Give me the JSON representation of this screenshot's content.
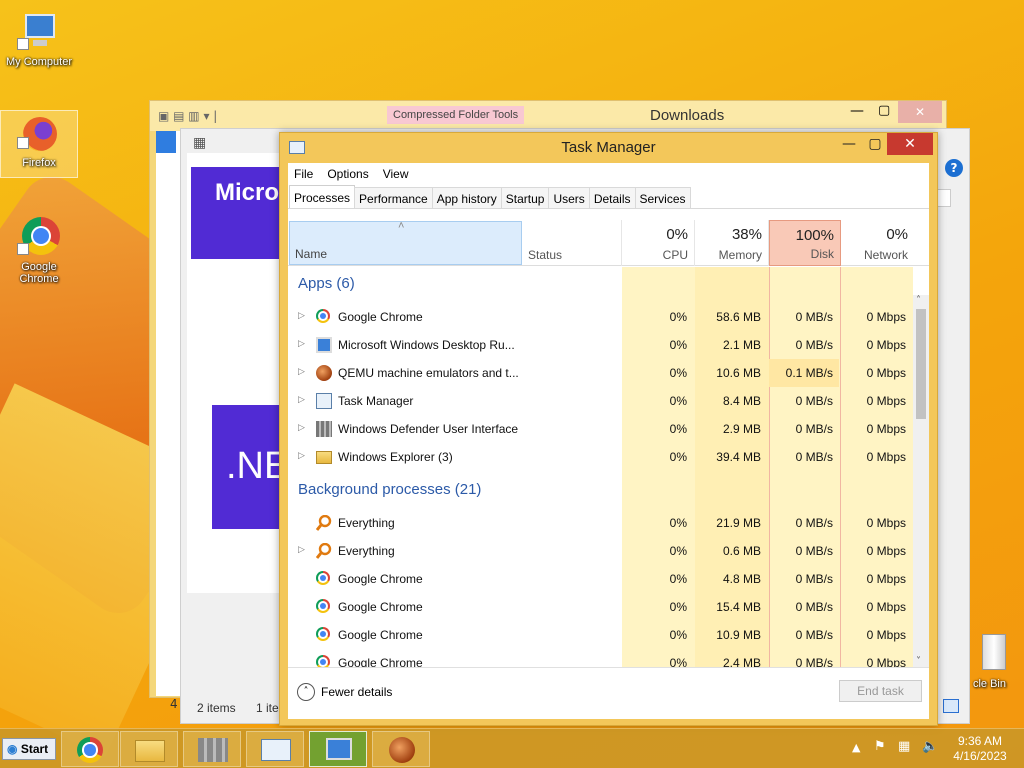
{
  "desktop": {
    "icons": [
      {
        "label": "My Computer"
      },
      {
        "label": "Firefox"
      },
      {
        "label": "Google Chrome"
      },
      {
        "label": "cle Bin"
      }
    ]
  },
  "explorer": {
    "ribbon_context": "Compressed Folder Tools",
    "title": "Downloads",
    "status_items": "2 items",
    "status_sel": "1 ite",
    "status_left": "4",
    "inner_heading": "Micro",
    "inner_logo": ".NE"
  },
  "task_manager": {
    "title": "Task Manager",
    "menu": [
      "File",
      "Options",
      "View"
    ],
    "tabs": [
      "Processes",
      "Performance",
      "App history",
      "Startup",
      "Users",
      "Details",
      "Services"
    ],
    "columns": {
      "name": "Name",
      "status": "Status",
      "cpu": {
        "pct": "0%",
        "label": "CPU"
      },
      "memory": {
        "pct": "38%",
        "label": "Memory"
      },
      "disk": {
        "pct": "100%",
        "label": "Disk"
      },
      "network": {
        "pct": "0%",
        "label": "Network"
      }
    },
    "groups": {
      "apps": "Apps (6)",
      "background": "Background processes (21)"
    },
    "apps": [
      {
        "name": "Google Chrome",
        "cpu": "0%",
        "mem": "58.6 MB",
        "disk": "0 MB/s",
        "net": "0 Mbps",
        "icon": "chrome-icon"
      },
      {
        "name": "Microsoft Windows Desktop Ru...",
        "cpu": "0%",
        "mem": "2.1 MB",
        "disk": "0 MB/s",
        "net": "0 Mbps",
        "icon": "remote-desktop-icon"
      },
      {
        "name": "QEMU machine emulators and t...",
        "cpu": "0%",
        "mem": "10.6 MB",
        "disk": "0.1 MB/s",
        "net": "0 Mbps",
        "icon": "qemu-icon"
      },
      {
        "name": "Task Manager",
        "cpu": "0%",
        "mem": "8.4 MB",
        "disk": "0 MB/s",
        "net": "0 Mbps",
        "icon": "task-manager-icon"
      },
      {
        "name": "Windows Defender User Interface",
        "cpu": "0%",
        "mem": "2.9 MB",
        "disk": "0 MB/s",
        "net": "0 Mbps",
        "icon": "defender-icon"
      },
      {
        "name": "Windows Explorer (3)",
        "cpu": "0%",
        "mem": "39.4 MB",
        "disk": "0 MB/s",
        "net": "0 Mbps",
        "icon": "folder-icon"
      }
    ],
    "background": [
      {
        "name": "Everything",
        "cpu": "0%",
        "mem": "21.9 MB",
        "disk": "0 MB/s",
        "net": "0 Mbps",
        "icon": "search-icon",
        "expand": false
      },
      {
        "name": "Everything",
        "cpu": "0%",
        "mem": "0.6 MB",
        "disk": "0 MB/s",
        "net": "0 Mbps",
        "icon": "search-icon",
        "expand": true
      },
      {
        "name": "Google Chrome",
        "cpu": "0%",
        "mem": "4.8 MB",
        "disk": "0 MB/s",
        "net": "0 Mbps",
        "icon": "chrome-icon",
        "expand": false
      },
      {
        "name": "Google Chrome",
        "cpu": "0%",
        "mem": "15.4 MB",
        "disk": "0 MB/s",
        "net": "0 Mbps",
        "icon": "chrome-icon",
        "expand": false
      },
      {
        "name": "Google Chrome",
        "cpu": "0%",
        "mem": "10.9 MB",
        "disk": "0 MB/s",
        "net": "0 Mbps",
        "icon": "chrome-icon",
        "expand": false
      },
      {
        "name": "Google Chrome",
        "cpu": "0%",
        "mem": "2.4 MB",
        "disk": "0 MB/s",
        "net": "0 Mbps",
        "icon": "chrome-icon",
        "expand": false
      }
    ],
    "fewer_details": "Fewer details",
    "end_task": "End task"
  },
  "taskbar": {
    "start": "Start",
    "time": "9:36 AM",
    "date": "4/16/2023"
  },
  "colors": {
    "accent": "#f3c75a",
    "disk_highlight": "#f9c9b7",
    "heat_light": "#fff4c4",
    "heat_med": "#ffe7a3",
    "group_blue": "#2c5aa8",
    "close_red": "#c7392f"
  }
}
